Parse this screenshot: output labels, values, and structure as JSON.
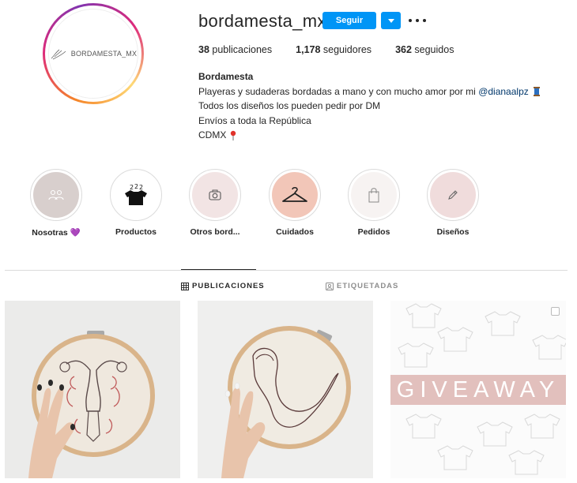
{
  "profile": {
    "avatar_text": "BORDAMESTA_MX",
    "username": "bordamesta_mx",
    "follow_label": "Seguir",
    "stats": [
      {
        "count": "38",
        "label": "publicaciones"
      },
      {
        "count": "1,178",
        "label": "seguidores"
      },
      {
        "count": "362",
        "label": "seguidos"
      }
    ]
  },
  "bio": {
    "name": "Bordamesta",
    "line1_prefix": "Playeras y sudaderas bordadas a mano y con mucho amor por mi ",
    "mention": "@dianaalpz",
    "line2": "Todos los diseños los pueden pedir por DM",
    "line3": "Envíos a toda la República",
    "line4": "CDMX"
  },
  "highlights": [
    {
      "label": "Nosotras 💜",
      "icon": "people-icon",
      "bg": "#d8cfcd"
    },
    {
      "label": "Productos",
      "icon": "shirts-icon",
      "bg": "#ffffff"
    },
    {
      "label": "Otros bord...",
      "icon": "camera-icon",
      "bg": "#f2e4e4"
    },
    {
      "label": "Cuidados",
      "icon": "hanger-icon",
      "bg": "#f2c6b8"
    },
    {
      "label": "Pedidos",
      "icon": "bag-icon",
      "bg": "#f7f3f2"
    },
    {
      "label": "Diseños",
      "icon": "pencil-icon",
      "bg": "#f0dcdc"
    }
  ],
  "tabs": {
    "posts": "PUBLICACIONES",
    "tagged": "ETIQUETADAS"
  },
  "posts": {
    "giveaway": "GIVEAWAY"
  },
  "colors": {
    "accent": "#0095f6",
    "mention": "#00376b",
    "giveaway_band": "#e2c0bd"
  }
}
